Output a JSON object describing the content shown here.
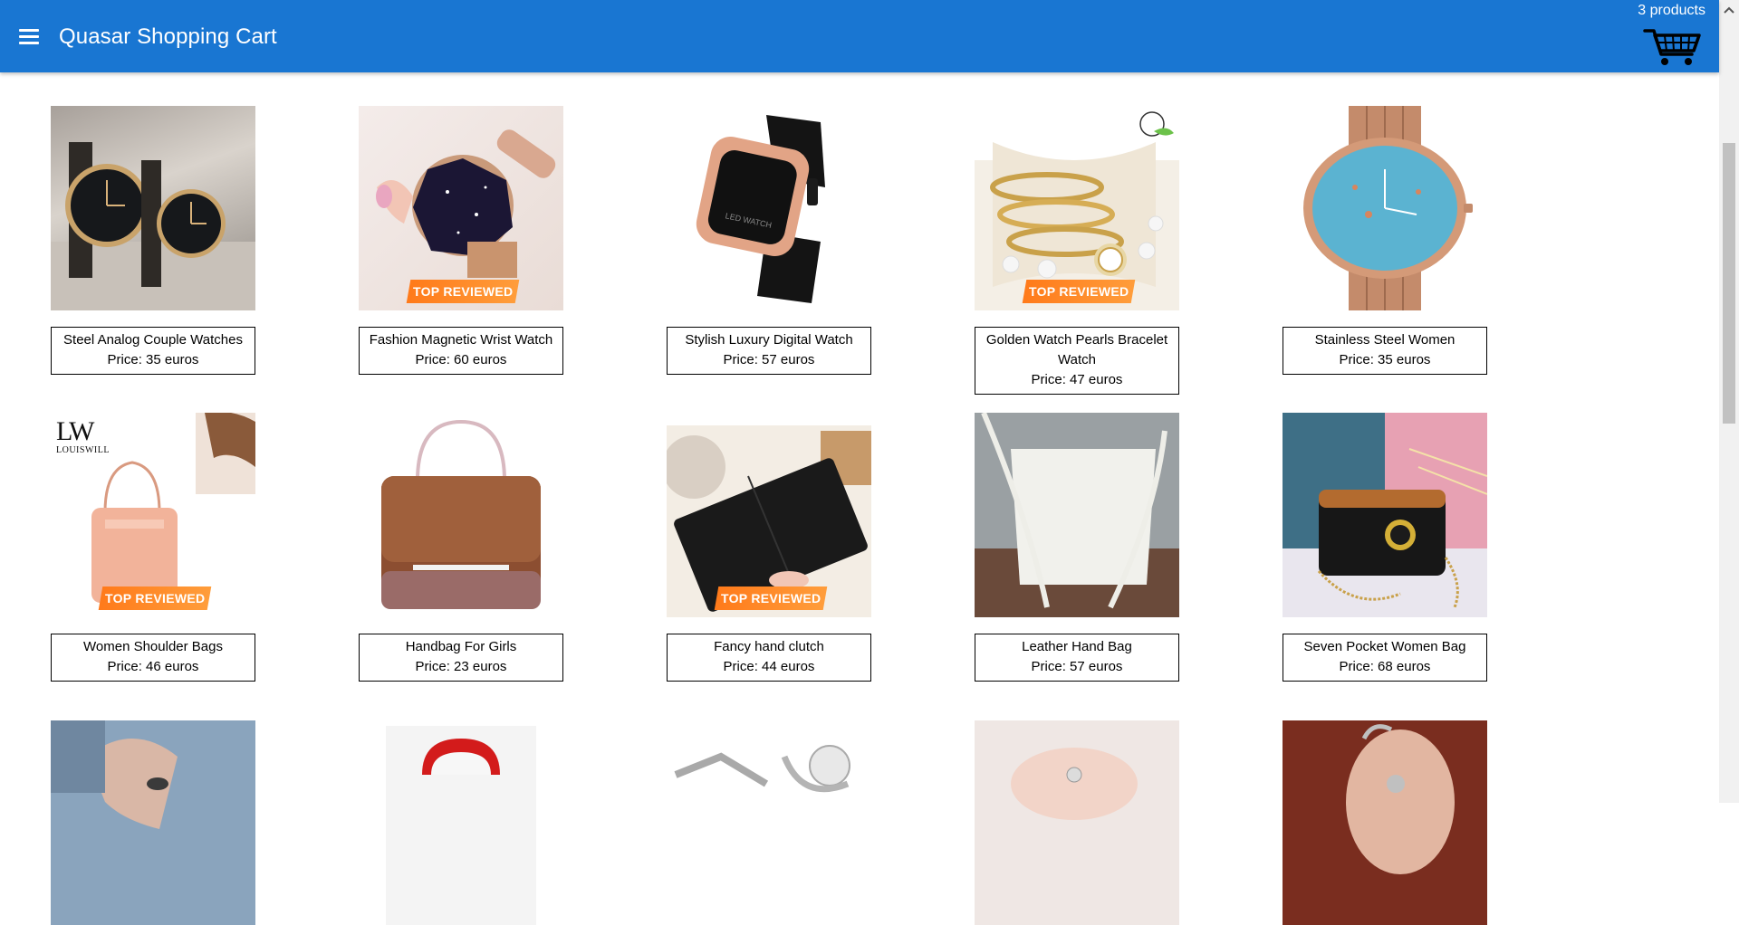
{
  "header": {
    "title": "Quasar Shopping Cart",
    "cart_count": "3 products"
  },
  "products": [
    {
      "name": "Steel Analog Couple Watches",
      "price": "Price: 35 euros",
      "image": "couple-watches",
      "badge": ""
    },
    {
      "name": "Fashion Magnetic Wrist Watch",
      "price": "Price: 60 euros",
      "image": "magnetic-watch",
      "badge": "TOP REVIEWED"
    },
    {
      "name": "Stylish Luxury Digital Watch",
      "price": "Price: 57 euros",
      "image": "digital-watch",
      "badge": ""
    },
    {
      "name": "Golden Watch Pearls Bracelet Watch",
      "price": "Price: 47 euros",
      "image": "pearls-bracelet",
      "badge": "TOP REVIEWED"
    },
    {
      "name": "Stainless Steel Women",
      "price": "Price: 35 euros",
      "image": "rose-gold-watch",
      "badge": ""
    },
    {
      "name": "Women Shoulder Bags",
      "price": "Price: 46 euros",
      "image": "pink-shoulder-bag",
      "badge": "TOP REVIEWED",
      "brand_mark": "LW",
      "brand_name": "LOUISWILL"
    },
    {
      "name": "Handbag For Girls",
      "price": "Price: 23 euros",
      "image": "brown-handbag",
      "badge": ""
    },
    {
      "name": "Fancy hand clutch",
      "price": "Price: 44 euros",
      "image": "black-clutch",
      "badge": "TOP REVIEWED"
    },
    {
      "name": "Leather Hand Bag",
      "price": "Price: 57 euros",
      "image": "white-hand-bag",
      "badge": ""
    },
    {
      "name": "Seven Pocket Women Bag",
      "price": "Price: 68 euros",
      "image": "black-pocket-bag",
      "badge": ""
    },
    {
      "name": "",
      "price": "",
      "image": "ring-hand",
      "badge": ""
    },
    {
      "name": "",
      "price": "",
      "image": "red-ring-box",
      "badge": ""
    },
    {
      "name": "",
      "price": "",
      "image": "silver-rings",
      "badge": ""
    },
    {
      "name": "",
      "price": "",
      "image": "finger-ring",
      "badge": ""
    },
    {
      "name": "",
      "price": "",
      "image": "ear-cuff",
      "badge": ""
    }
  ],
  "icons": {
    "menu": "menu-icon",
    "cart": "shopping-cart-icon"
  },
  "colors": {
    "primary": "#1976d2",
    "badge": "#ff8c2a"
  }
}
